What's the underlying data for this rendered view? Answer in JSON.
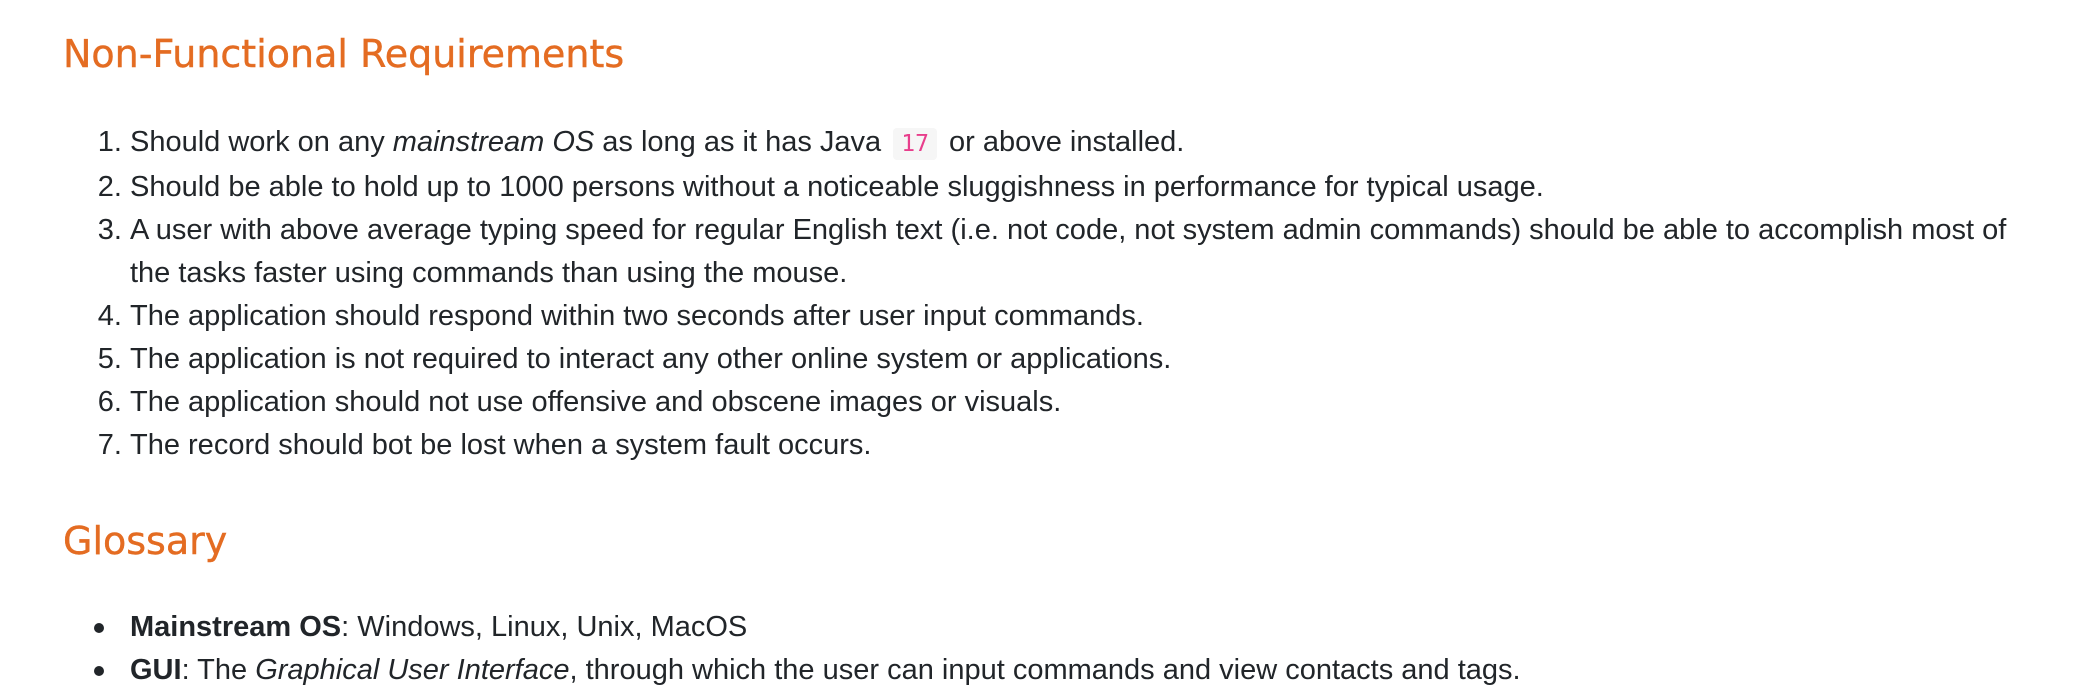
{
  "sections": {
    "nfr": {
      "heading": "Non-Functional Requirements",
      "items": [
        {
          "pre": "Should work on any ",
          "em": "mainstream OS",
          "mid": " as long as it has Java ",
          "code": "17",
          "post": " or above installed."
        },
        {
          "text": "Should be able to hold up to 1000 persons without a noticeable sluggishness in performance for typical usage."
        },
        {
          "text": "A user with above average typing speed for regular English text (i.e. not code, not system admin commands) should be able to accomplish most of the tasks faster using commands than using the mouse."
        },
        {
          "text": "The application should respond within two seconds after user input commands."
        },
        {
          "text": "The application is not required to interact any other online system or applications."
        },
        {
          "text": "The application should not use offensive and obscene images or visuals."
        },
        {
          "text": "The record should bot be lost when a system fault occurs."
        }
      ]
    },
    "glossary": {
      "heading": "Glossary",
      "items": [
        {
          "term": "Mainstream OS",
          "text": ": Windows, Linux, Unix, MacOS"
        },
        {
          "term": "GUI",
          "pre": ": The ",
          "em": "Graphical User Interface",
          "post": ", through which the user can input commands and view contacts and tags."
        }
      ]
    }
  },
  "colors": {
    "heading": "#e46c22",
    "code_text": "#e83e8c",
    "code_bg": "#f6f6f6",
    "body_text": "#212529"
  }
}
